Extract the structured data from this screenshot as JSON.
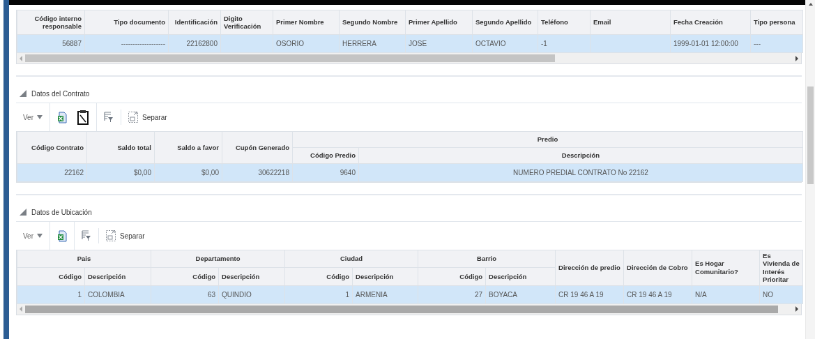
{
  "top_table": {
    "columns": [
      {
        "label": "Código interno responsable",
        "kind": "number"
      },
      {
        "label": "Tipo documento",
        "kind": "number"
      },
      {
        "label": "Identificación",
        "kind": "number"
      },
      {
        "label": "Digito Verificación",
        "kind": "text"
      },
      {
        "label": "Primer Nombre",
        "kind": "text"
      },
      {
        "label": "Segundo Nombre",
        "kind": "text"
      },
      {
        "label": "Primer Apellido",
        "kind": "text"
      },
      {
        "label": "Segundo Apellido",
        "kind": "text"
      },
      {
        "label": "Teléfono",
        "kind": "text"
      },
      {
        "label": "Email",
        "kind": "text"
      },
      {
        "label": "Fecha Creación",
        "kind": "text"
      },
      {
        "label": "Tipo persona",
        "kind": "text"
      }
    ],
    "rows": [
      {
        "selected": true,
        "cells": [
          "56887",
          "-------------------",
          "22162800",
          "",
          "OSORIO",
          "HERRERA",
          "JOSE",
          "OCTAVIO",
          "-1",
          "",
          "1999-01-01 12:00:00",
          "---"
        ]
      }
    ]
  },
  "sections": [
    {
      "title": "Datos del Contrato",
      "expanded": true,
      "toolbar": [
        [
          {
            "kind": "view",
            "label": "Ver"
          }
        ],
        [
          {
            "kind": "excel"
          },
          {
            "kind": "clipboard"
          }
        ],
        [
          {
            "kind": "filter"
          }
        ],
        [
          {
            "kind": "detach",
            "label": "Separar"
          }
        ]
      ],
      "table": {
        "header_rows": [
          [
            {
              "label": "Código Contrato",
              "kind": "number",
              "rowspan": 2
            },
            {
              "label": "Saldo total",
              "kind": "number",
              "rowspan": 2
            },
            {
              "label": "Saldo a favor",
              "kind": "number",
              "rowspan": 2
            },
            {
              "label": "Cupón Generado",
              "kind": "number",
              "rowspan": 2
            },
            {
              "label": "Predio",
              "kind": "group",
              "colspan": 2
            }
          ],
          [
            {
              "label": "Código Predio",
              "kind": "number"
            },
            {
              "label": "Descripción",
              "kind": "center"
            }
          ]
        ],
        "rows": [
          {
            "selected": true,
            "cells": [
              "22162",
              "$0,00",
              "$0,00",
              "30622218",
              "9640",
              "NUMERO PREDIAL CONTRATO No 22162"
            ]
          }
        ]
      },
      "scrollbar": false
    },
    {
      "title": "Datos de Ubicación",
      "expanded": true,
      "toolbar": [
        [
          {
            "kind": "view",
            "label": "Ver"
          }
        ],
        [
          {
            "kind": "excel"
          }
        ],
        [
          {
            "kind": "filter"
          }
        ],
        [
          {
            "kind": "detach",
            "label": "Separar"
          }
        ]
      ],
      "table": {
        "header_rows": [
          [
            {
              "label": "Pais",
              "kind": "group",
              "colspan": 2
            },
            {
              "label": "Departamento",
              "kind": "group",
              "colspan": 2
            },
            {
              "label": "Ciudad",
              "kind": "group",
              "colspan": 2
            },
            {
              "label": "Barrio",
              "kind": "group",
              "colspan": 2
            },
            {
              "label": "Dirección de predio",
              "kind": "text",
              "rowspan": 2
            },
            {
              "label": "Dirección de Cobro",
              "kind": "text",
              "rowspan": 2
            },
            {
              "label": "Es Hogar Comunitario?",
              "kind": "text",
              "rowspan": 2
            },
            {
              "label": "Es Vivienda de Interés Prioritar",
              "kind": "text",
              "rowspan": 2
            }
          ],
          [
            {
              "label": "Código",
              "kind": "number"
            },
            {
              "label": "Descripción",
              "kind": "text"
            },
            {
              "label": "Código",
              "kind": "number"
            },
            {
              "label": "Descripción",
              "kind": "text"
            },
            {
              "label": "Código",
              "kind": "number"
            },
            {
              "label": "Descripción",
              "kind": "text"
            },
            {
              "label": "Código",
              "kind": "number"
            },
            {
              "label": "Descripción",
              "kind": "text"
            }
          ]
        ],
        "rows": [
          {
            "selected": true,
            "cells": [
              "1",
              "COLOMBIA",
              "63",
              "QUINDIO",
              "1",
              "ARMENIA",
              "27",
              "BOYACA",
              "CR 19 46 A 19",
              "CR 19 46 A 19",
              "N/A",
              "NO"
            ]
          }
        ]
      },
      "scrollbar": true
    }
  ]
}
